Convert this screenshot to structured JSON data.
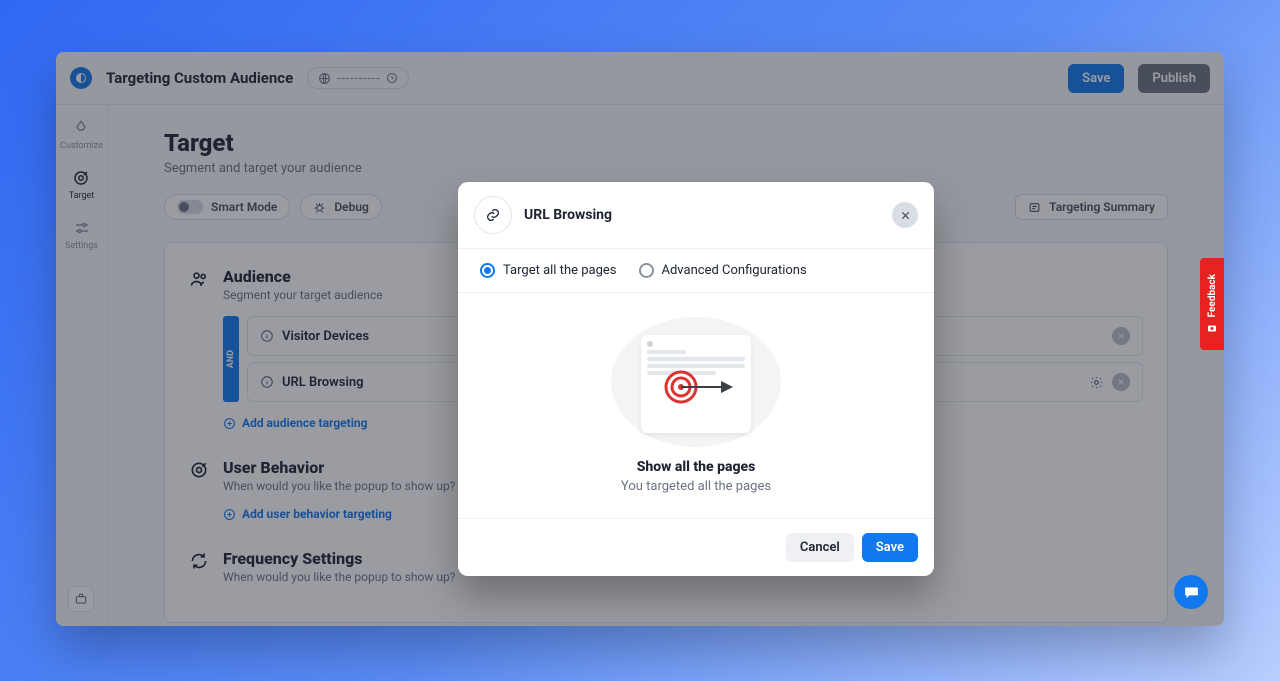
{
  "topbar": {
    "title": "Targeting Custom Audience",
    "status_dashes": "----------",
    "save": "Save",
    "publish": "Publish"
  },
  "sidebar": {
    "items": [
      {
        "label": "Customize"
      },
      {
        "label": "Target"
      },
      {
        "label": "Settings"
      }
    ]
  },
  "page": {
    "h1": "Target",
    "sub": "Segment and target your audience",
    "smart_mode": "Smart Mode",
    "debug": "Debug",
    "summary": "Targeting Summary"
  },
  "audience": {
    "title": "Audience",
    "desc": "Segment your target audience",
    "and": "AND",
    "rules": [
      {
        "label": "Visitor Devices"
      },
      {
        "label": "URL Browsing"
      }
    ],
    "add": "Add audience targeting"
  },
  "behavior": {
    "title": "User Behavior",
    "desc": "When would you like the popup to show up?",
    "add": "Add user behavior targeting"
  },
  "freq": {
    "title": "Frequency Settings",
    "desc": "When would you like the popup to show up?"
  },
  "modal": {
    "title": "URL Browsing",
    "opt_all": "Target all the pages",
    "opt_adv": "Advanced Configurations",
    "body_title": "Show all the pages",
    "body_sub": "You targeted all the pages",
    "cancel": "Cancel",
    "save": "Save"
  },
  "feedback": {
    "label": "Feedback"
  }
}
